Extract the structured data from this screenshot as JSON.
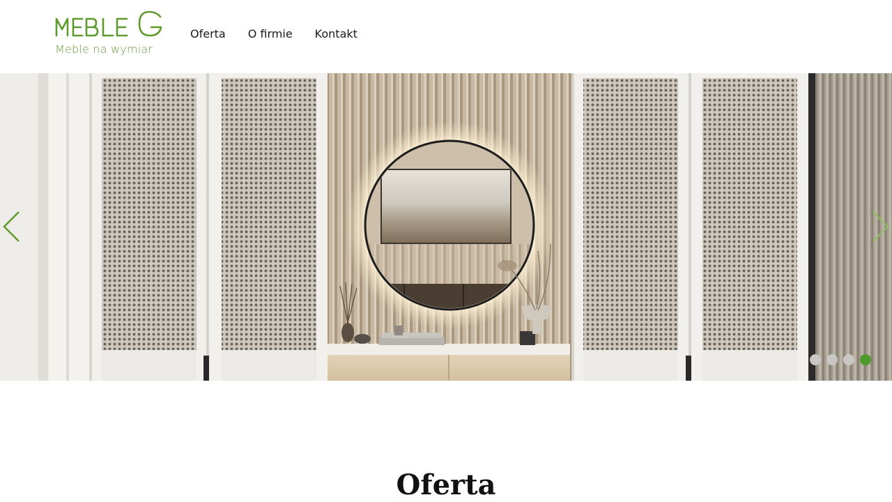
{
  "brand": {
    "name": "MEBLEG",
    "tagline": "Meble na wymiar",
    "color": "#5e9a2d"
  },
  "nav": {
    "items": [
      "Oferta",
      "O firmie",
      "Kontakt"
    ]
  },
  "slider": {
    "slide_count": 4,
    "active_index": 3,
    "accent": "#4e9a2a",
    "prev_icon": "chevron-left-icon",
    "next_icon": "chevron-right-icon"
  },
  "section": {
    "title": "Oferta"
  }
}
